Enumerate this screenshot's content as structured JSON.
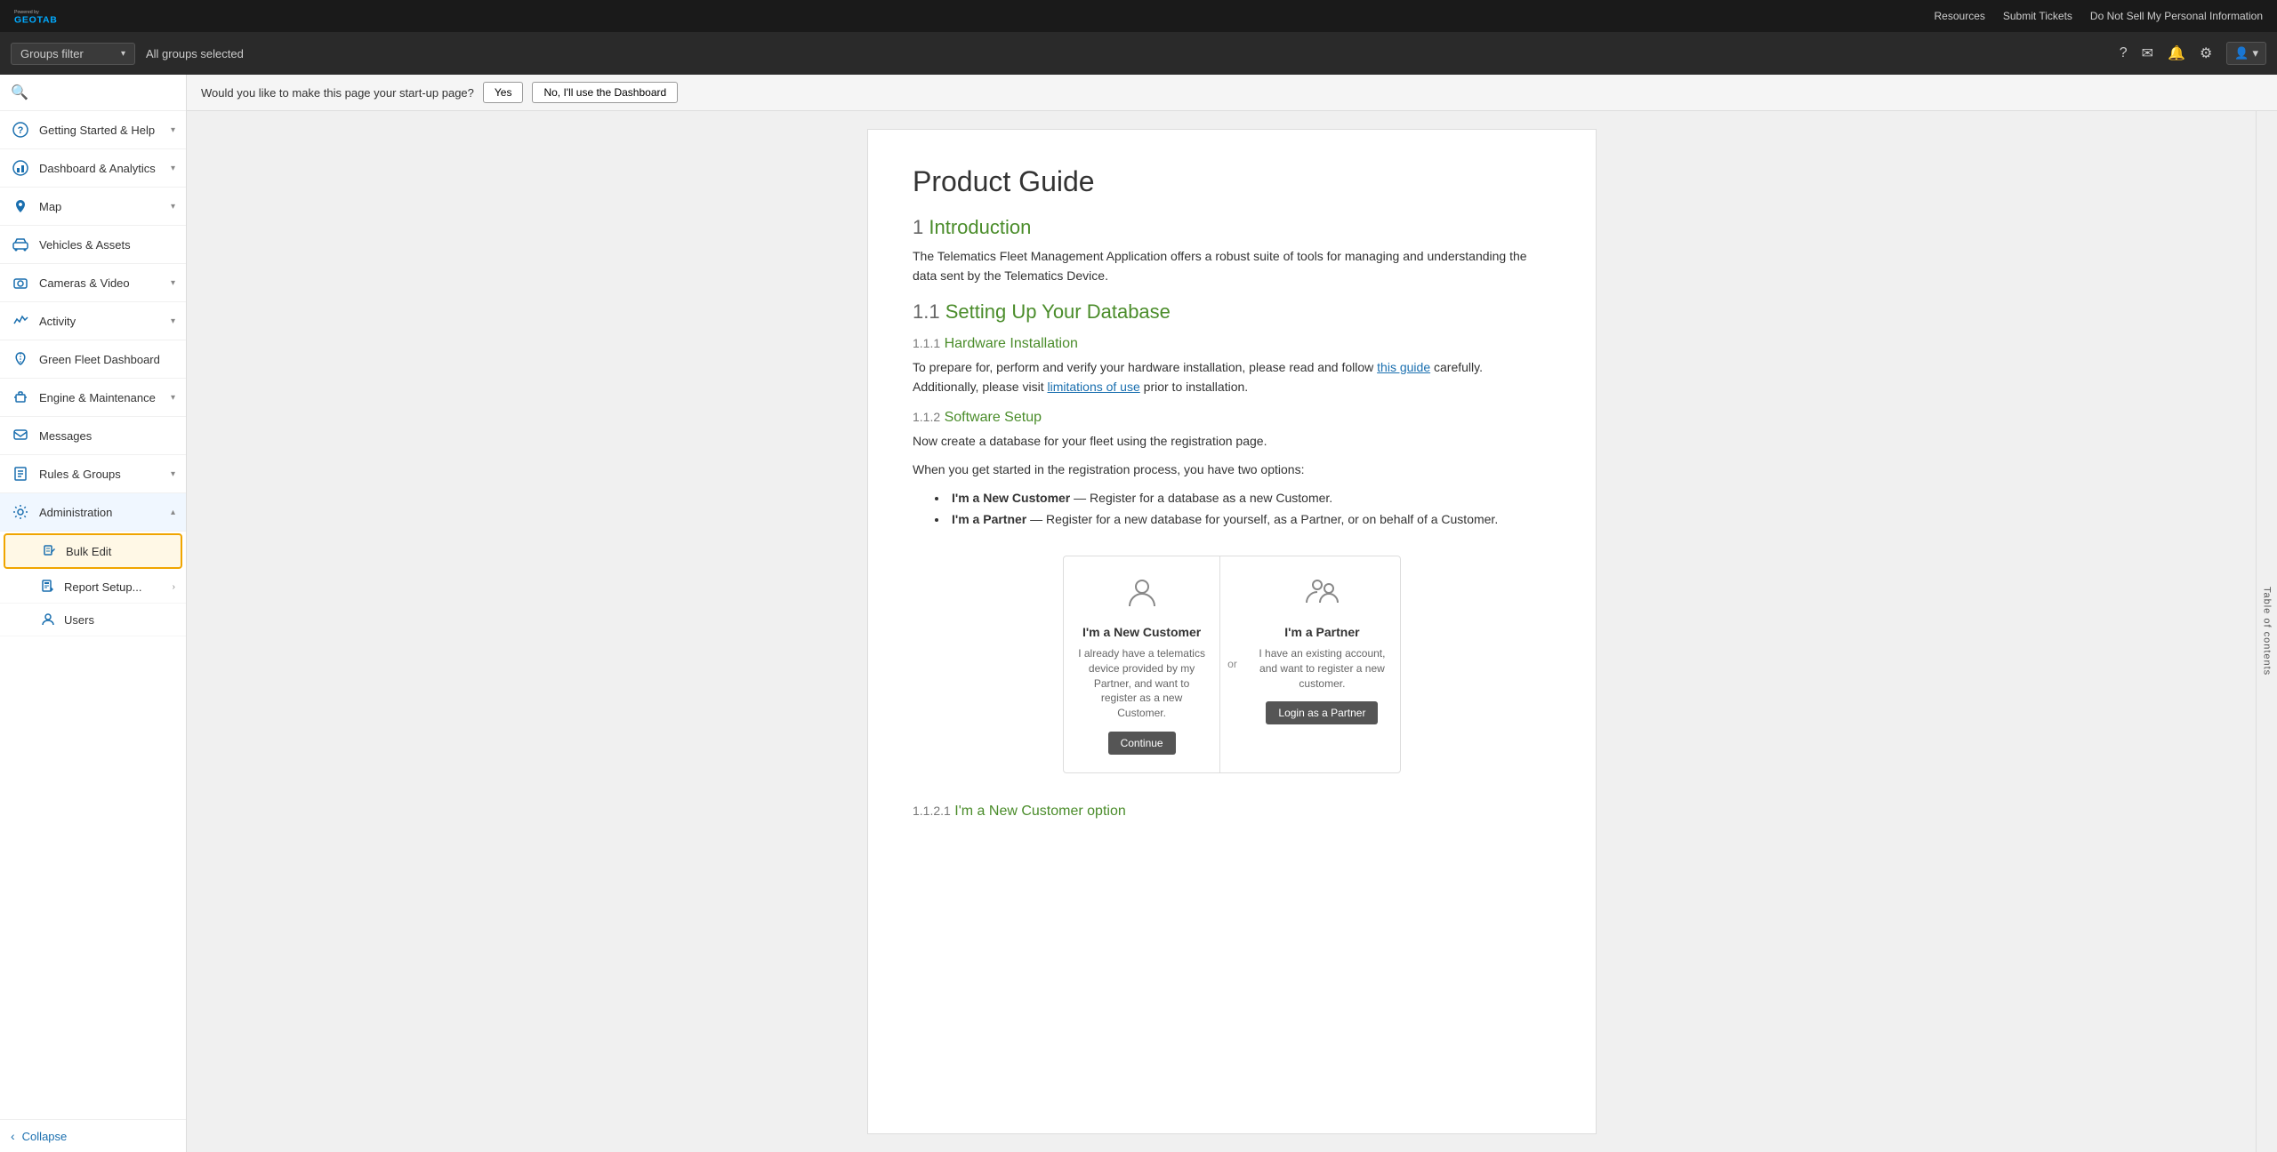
{
  "topbar": {
    "logo_top": "Powered by",
    "logo_name": "GEOTAB",
    "links": [
      "Resources",
      "Submit Tickets",
      "Do Not Sell My Personal Information"
    ]
  },
  "secondbar": {
    "groups_filter_label": "Groups filter",
    "all_groups_label": "All groups selected"
  },
  "sidebar": {
    "search_placeholder": "Search",
    "nav_items": [
      {
        "id": "getting-started",
        "label": "Getting Started & Help",
        "icon": "❓",
        "has_chevron": true,
        "expanded": false
      },
      {
        "id": "dashboard",
        "label": "Dashboard & Analytics",
        "icon": "📊",
        "has_chevron": true,
        "expanded": false
      },
      {
        "id": "map",
        "label": "Map",
        "icon": "🗺️",
        "has_chevron": true,
        "expanded": false
      },
      {
        "id": "vehicles",
        "label": "Vehicles & Assets",
        "icon": "🚚",
        "has_chevron": false,
        "expanded": false
      },
      {
        "id": "cameras",
        "label": "Cameras & Video",
        "icon": "📷",
        "has_chevron": true,
        "expanded": false
      },
      {
        "id": "activity",
        "label": "Activity",
        "icon": "📈",
        "has_chevron": true,
        "expanded": false
      },
      {
        "id": "green-fleet",
        "label": "Green Fleet Dashboard",
        "icon": "🌿",
        "has_chevron": false,
        "expanded": false
      },
      {
        "id": "engine",
        "label": "Engine & Maintenance",
        "icon": "🔧",
        "has_chevron": true,
        "expanded": false
      },
      {
        "id": "messages",
        "label": "Messages",
        "icon": "✉️",
        "has_chevron": false,
        "expanded": false
      },
      {
        "id": "rules",
        "label": "Rules & Groups",
        "icon": "📋",
        "has_chevron": true,
        "expanded": false
      },
      {
        "id": "administration",
        "label": "Administration",
        "icon": "⚙️",
        "has_chevron": true,
        "expanded": true
      }
    ],
    "admin_sub_items": [
      {
        "id": "bulk-edit",
        "label": "Bulk Edit",
        "icon": "✏️",
        "highlighted": true
      },
      {
        "id": "report-setup",
        "label": "Report Setup...",
        "icon": "📑",
        "has_arrow": true
      },
      {
        "id": "users",
        "label": "Users",
        "icon": "👤"
      }
    ],
    "collapse_label": "Collapse"
  },
  "startup_bar": {
    "question": "Would you like to make this page your start-up page?",
    "yes_label": "Yes",
    "no_label": "No, I'll use the Dashboard"
  },
  "document": {
    "title": "Product Guide",
    "section1_num": "1",
    "section1_title": "Introduction",
    "section1_para": "The Telematics Fleet Management Application offers a robust suite of tools for managing and understanding the data sent by the Telematics Device.",
    "section11_num": "1.1",
    "section11_title": "Setting Up Your Database",
    "section111_num": "1.1.1",
    "section111_title": "Hardware Installation",
    "section111_para1": "To prepare for, perform and verify your hardware installation, please read and follow ",
    "section111_link1": "this guide",
    "section111_para2": " carefully. Additionally, please visit ",
    "section111_link2": "limitations of use",
    "section111_para3": " prior to installation.",
    "section112_num": "1.1.2",
    "section112_title": "Software Setup",
    "section112_para1": "Now create a database for your fleet using the registration page.",
    "section112_para2": "When you get started in the registration process, you have two options:",
    "section112_list": [
      {
        "bold": "I'm a New Customer",
        "rest": " — Register for a database as a new Customer."
      },
      {
        "bold": "I'm a Partner",
        "rest": " — Register for a new database for yourself, as a Partner, or on behalf of a Customer."
      }
    ],
    "reg_new_customer_title": "I'm a New Customer",
    "reg_new_customer_desc": "I already have a telematics device provided by my Partner, and want to register as a new Customer.",
    "reg_new_customer_btn": "Continue",
    "reg_partner_title": "I'm a Partner",
    "reg_partner_desc": "I have an existing account, and want to register a new customer.",
    "reg_partner_btn": "Login as a Partner",
    "section1121_num": "1.1.2.1",
    "section1121_title": "I'm a New Customer option",
    "toc_label": "Table of contents"
  },
  "icons": {
    "search": "🔍",
    "help": "?",
    "mail": "✉",
    "bell": "🔔",
    "gear": "⚙",
    "user": "👤",
    "chevron_down": "▾",
    "chevron_right": "›",
    "chevron_left": "‹",
    "collapse_left": "‹"
  }
}
